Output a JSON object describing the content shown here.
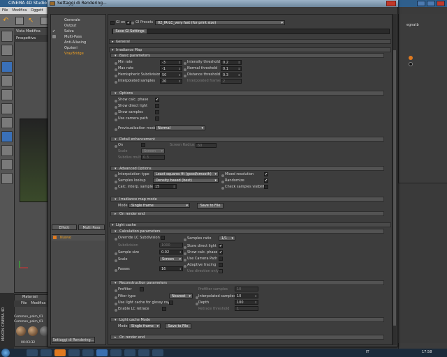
{
  "app": {
    "title": "CINEMA 4D Studio -",
    "menu": [
      "File",
      "Modifica",
      "Oggett"
    ],
    "viewport_menu": [
      "Vista",
      "Modifica",
      "Ca"
    ],
    "viewport_tab": "Prospettiva",
    "materials_title": "Materiali",
    "materials_menu": [
      "File",
      "Modifica"
    ],
    "materials": [
      "Common_palm_01",
      "Common_palm_01"
    ],
    "timecode": "00:03:32",
    "brand": "MAXON CINEMA 4D",
    "right_panel_label": "egnatb"
  },
  "dialog": {
    "title": "Settaggi di Rendering...",
    "nav": [
      {
        "label": "Generale",
        "active": false,
        "checked": false
      },
      {
        "label": "Output",
        "active": false,
        "checked": false
      },
      {
        "label": "Salva",
        "active": false,
        "checked": true
      },
      {
        "label": "Multi-Pass",
        "active": false,
        "checked": false
      },
      {
        "label": "Anti-Aliasing",
        "active": false,
        "checked": false
      },
      {
        "label": "Opzioni",
        "active": false,
        "checked": false
      },
      {
        "label": "VrayBridge",
        "active": true,
        "checked": false
      }
    ],
    "effects_button": "Effetti",
    "multipass_button": "Multi Pass",
    "new_item": "Nuovo",
    "settings_button": "Settaggi di Rendering..."
  },
  "top": {
    "gi_on_label": "GI on",
    "gi_presets_label": "GI Presets",
    "gi_presets_value": "02_IR-LC_very fast (for print size)",
    "save_gi_button": "Save GI Settings"
  },
  "general": {
    "label": "General"
  },
  "irradiance": {
    "label": "Irradiance Map",
    "basic": {
      "label": "Basic parameters",
      "min_rate_label": "Min rate",
      "min_rate": "-3",
      "max_rate_label": "Max rate",
      "max_rate": "-1",
      "hemispheric_label": "Hemispheric Subdivision",
      "hemispheric": "50",
      "interp_samples_label": "Interpolated samples",
      "interp_samples": "20",
      "intensity_label": "Intensity threshold",
      "intensity": "0.2",
      "normal_label": "Normal threshold",
      "normal": "0.1",
      "distance_label": "Distance threshold",
      "distance": "0.3",
      "interp_frames_label": "Interpolated frames",
      "interp_frames": "2"
    },
    "options": {
      "label": "Options",
      "show_calc": "Show calc. phase",
      "show_direct": "Show direct light",
      "show_samples": "Show samples",
      "use_camera": "Use camera path",
      "prev_label": "Previsualization mode",
      "prev_value": "Normal"
    },
    "detail": {
      "label": "Detail enhancement",
      "on": "On",
      "screen_radius_label": "Screen Radius",
      "screen_radius": "60",
      "scale_label": "Scale",
      "scale_value": "Screen",
      "subdivs_label": "Subdivs mult.",
      "subdivs": "0.3"
    },
    "advanced": {
      "label": "Advanced Options",
      "interp_type_label": "Interpolation type",
      "interp_type": "Least squares fit (good/smooth)",
      "lookup_label": "Samples lookup",
      "lookup": "Density based (best)",
      "calc_interp_label": "Calc. interp. samples",
      "calc_interp": "15",
      "multipass": "Mixed resolution",
      "randomize": "Randomize",
      "check_vis": "Check samples visibility"
    },
    "mode": {
      "label": "Irradiance map mode",
      "mode_label": "Mode",
      "mode_value": "Single frame",
      "save_button": "Save to File"
    },
    "on_render_end": "On render end"
  },
  "light_cache": {
    "label": "Light cache",
    "calc": {
      "label": "Calculation parameters",
      "override": "Override LC Subdivision",
      "subdivision_label": "Subdivision",
      "subdivision": "1000",
      "sample_size_label": "Sample size",
      "sample_size": "0.02",
      "scale_label": "Scale",
      "scale_value": "Screen",
      "passes_label": "Passes",
      "passes": "16",
      "sample_ratio_label": "Samples ratio",
      "sample_ratio": "1/1",
      "store_direct": "Store direct light",
      "show_calc": "Show calc. phase",
      "use_camera": "Use Camera Path",
      "adaptive": "Adaptive tracing",
      "use_dirs": "Use direction only"
    },
    "recon": {
      "label": "Reconstruction parameters",
      "prefilter": "Prefilter",
      "prefilter_samples_label": "Prefilter samples",
      "prefilter_samples": "10",
      "filter_label": "Filter type",
      "filter_value": "Nearest",
      "interp_label": "Interpolated samples",
      "interp": "10",
      "glossy": "Use light cache for glossy rays",
      "depth_label": "Depth",
      "depth": "100",
      "retrace": "Enable LC retrace",
      "retrace_threshold_label": "Retrace threshold",
      "retrace_threshold": "1"
    },
    "mode": {
      "label": "Light cache Mode",
      "mode_label": "Mode",
      "mode_value": "Single frame",
      "save_button": "Save to File"
    },
    "on_render_end": "On render end"
  },
  "taskbar": {
    "lang": "IT",
    "time": "17:58"
  }
}
